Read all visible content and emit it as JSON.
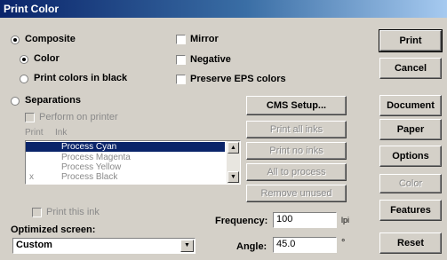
{
  "window": {
    "title": "Print Color"
  },
  "options": {
    "composite": "Composite",
    "color": "Color",
    "print_black": "Print colors in black",
    "separations": "Separations",
    "perform_on_printer": "Perform on printer",
    "mirror": "Mirror",
    "negative": "Negative",
    "preserve_eps": "Preserve EPS colors"
  },
  "inks": {
    "col_print": "Print",
    "col_ink": "Ink",
    "items": [
      {
        "mark": "",
        "name": "Process Cyan"
      },
      {
        "mark": "",
        "name": "Process Magenta"
      },
      {
        "mark": "",
        "name": "Process Yellow"
      },
      {
        "mark": "x",
        "name": "Process Black"
      }
    ],
    "print_this_ink": "Print this ink"
  },
  "ink_buttons": {
    "cms_setup": "CMS Setup...",
    "print_all": "Print all inks",
    "print_none": "Print no inks",
    "all_to_process": "All to process",
    "remove_unused": "Remove unused"
  },
  "screen": {
    "label": "Optimized screen:",
    "value": "Custom",
    "frequency_label": "Frequency:",
    "frequency_value": "100",
    "frequency_unit": "lpi",
    "angle_label": "Angle:",
    "angle_value": "45.0",
    "angle_unit": "°"
  },
  "side_buttons": {
    "print": "Print",
    "cancel": "Cancel",
    "document": "Document",
    "paper": "Paper",
    "options": "Options",
    "color": "Color",
    "features": "Features",
    "reset": "Reset"
  }
}
